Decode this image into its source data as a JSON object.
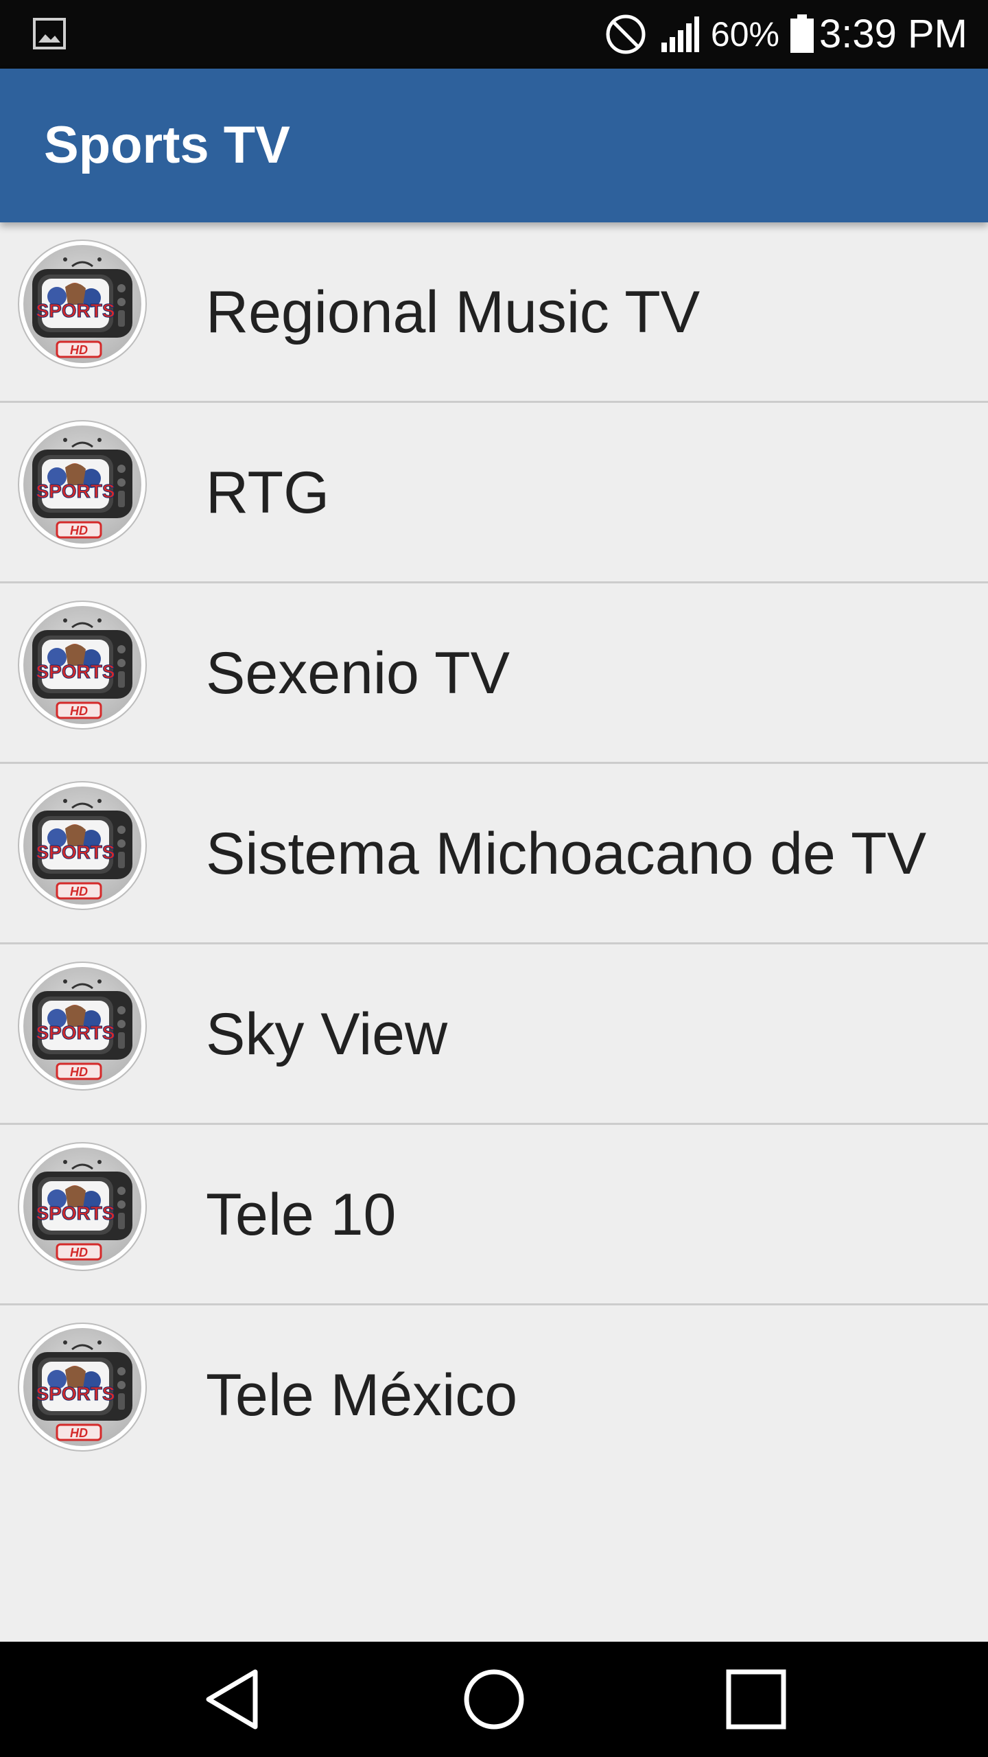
{
  "status_bar": {
    "notification_icon": "gallery-icon",
    "dnd_icon": "block-icon",
    "signal_icon": "signal-icon",
    "battery_percent": "60%",
    "battery_icon": "battery-icon",
    "time": "3:39 PM"
  },
  "app_bar": {
    "title": "Sports TV",
    "color": "#2e619c"
  },
  "channels": [
    {
      "name": "Regional Music TV",
      "icon": "sports-hd-tv-icon"
    },
    {
      "name": "RTG",
      "icon": "sports-hd-tv-icon"
    },
    {
      "name": "Sexenio TV",
      "icon": "sports-hd-tv-icon"
    },
    {
      "name": "Sistema Michoacano de TV",
      "icon": "sports-hd-tv-icon"
    },
    {
      "name": "Sky View",
      "icon": "sports-hd-tv-icon"
    },
    {
      "name": "Tele 10",
      "icon": "sports-hd-tv-icon"
    },
    {
      "name": "Tele México",
      "icon": "sports-hd-tv-icon"
    }
  ],
  "nav_bar": {
    "back_icon": "back-triangle-icon",
    "home_icon": "home-circle-icon",
    "recents_icon": "recents-square-icon"
  }
}
